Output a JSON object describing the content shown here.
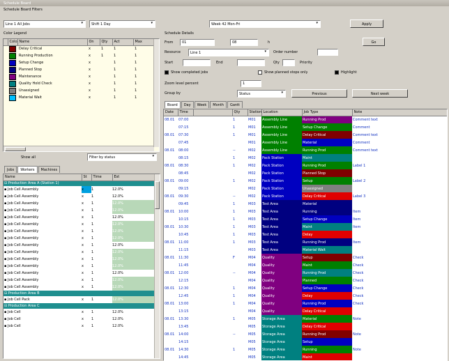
{
  "window": {
    "title": "Schedule Board"
  },
  "toolbar": {
    "group_label": "Schedule Board Filters",
    "combo1": "Line 1 All Jobs",
    "combo2": "Shift 1 Day",
    "combo3": "Week 42 Mon-Fri",
    "apply_label": "Apply"
  },
  "legend": {
    "title": "Color Legend",
    "headers": [
      "",
      "Color",
      "Name",
      "On",
      "Qty",
      "Act",
      "Max"
    ],
    "rows": [
      {
        "color": "#800000",
        "name": "Delay Critical",
        "on": "x",
        "qty": "1",
        "act": "1",
        "max": "1"
      },
      {
        "color": "#008000",
        "name": "Running Production",
        "on": "x",
        "qty": "1",
        "act": "1",
        "max": "1"
      },
      {
        "color": "#0000c0",
        "name": "Setup Change",
        "on": "x",
        "qty": "",
        "act": "1",
        "max": "1"
      },
      {
        "color": "#000080",
        "name": "Planned Stop",
        "on": "x",
        "qty": "",
        "act": "1",
        "max": "1"
      },
      {
        "color": "#800080",
        "name": "Maintenance",
        "on": "x",
        "qty": "",
        "act": "1",
        "max": "1"
      },
      {
        "color": "#008080",
        "name": "Quality Hold Check",
        "on": "x",
        "qty": "",
        "act": "1",
        "max": "1"
      },
      {
        "color": "#808080",
        "name": "Unassigned",
        "on": "x",
        "qty": "",
        "act": "1",
        "max": "1"
      },
      {
        "color": "#00c0ff",
        "name": "Material Wait",
        "on": "x",
        "qty": "",
        "act": "1",
        "max": "1"
      }
    ],
    "footer_left": "Show all",
    "footer_right": "Filter by status"
  },
  "lowerleft": {
    "tabs": [
      "Jobs",
      "Workers",
      "Machines"
    ],
    "headers": [
      "Name",
      "St",
      "Time",
      "Est"
    ],
    "groups": [
      {
        "label": "Production Area A (Station 1)",
        "rows": [
          {
            "name": "Job Cell Assembly",
            "st": "x",
            "time": "1",
            "est": "12.0%",
            "hl": false
          },
          {
            "name": "Job Cell Assembly",
            "st": "x",
            "time": "1",
            "est": "12.0%",
            "hl": false
          },
          {
            "name": "Job Cell Assembly",
            "st": "x",
            "time": "1",
            "est": "12.0%",
            "hl": true
          },
          {
            "name": "Job Cell Assembly",
            "st": "x",
            "time": "1",
            "est": "12.0%",
            "hl": true
          },
          {
            "name": "Job Cell Assembly",
            "st": "x",
            "time": "1",
            "est": "12.0%",
            "hl": false
          },
          {
            "name": "Job Cell Assembly",
            "st": "x",
            "time": "1",
            "est": "12.0%",
            "hl": true
          },
          {
            "name": "Job Cell Assembly",
            "st": "x",
            "time": "1",
            "est": "12.0%",
            "hl": true
          },
          {
            "name": "Job Cell Assembly",
            "st": "x",
            "time": "1",
            "est": "12.0%",
            "hl": true
          },
          {
            "name": "Job Cell Assembly",
            "st": "x",
            "time": "1",
            "est": "12.0%",
            "hl": false
          },
          {
            "name": "Job Cell Assembly",
            "st": "x",
            "time": "1",
            "est": "12.0%",
            "hl": true
          },
          {
            "name": "Job Cell Assembly",
            "st": "x",
            "time": "1",
            "est": "12.0%",
            "hl": true
          },
          {
            "name": "Job Cell Assembly",
            "st": "x",
            "time": "1",
            "est": "12.0%",
            "hl": true
          },
          {
            "name": "Job Cell Assembly",
            "st": "x",
            "time": "1",
            "est": "12.0%",
            "hl": false
          },
          {
            "name": "Job Cell Assembly",
            "st": "x",
            "time": "1",
            "est": "12.0%",
            "hl": true
          },
          {
            "name": "Job Cell Assembly",
            "st": "x",
            "time": "1",
            "est": "12.0%",
            "hl": true
          }
        ]
      },
      {
        "label": "Production Area B",
        "rows": [
          {
            "name": "Job Cell Pack",
            "st": "x",
            "time": "1",
            "est": "12.0%",
            "hl": true
          }
        ]
      },
      {
        "label": "Production Area C",
        "rows": [
          {
            "name": "Job Cell",
            "st": "x",
            "time": "1",
            "est": "12.0%",
            "hl": false
          },
          {
            "name": "Job Cell",
            "st": "x",
            "time": "1",
            "est": "12.0%",
            "hl": false
          },
          {
            "name": "Job Cell",
            "st": "x",
            "time": "1",
            "est": "12.0%",
            "hl": false
          }
        ]
      }
    ]
  },
  "details": {
    "title": "Schedule Details",
    "from_label": "From",
    "from_value": "01",
    "to_value": "08",
    "unit": "h",
    "go_label": "Go",
    "resource_label": "Resource",
    "resource_value": "Line 1",
    "order_label": "Order number",
    "order_value": "",
    "start_label": "Start",
    "start_value": "",
    "end_label": "End",
    "end_value": "",
    "qty_label": "Qty",
    "qty_value": "",
    "prio_label": "Priority",
    "check1": "Show completed jobs",
    "check2": "Show planned stops only",
    "check3": "Highlight",
    "zoom_label": "Zoom level percent",
    "zoom_value": "1",
    "view_label": "Group by",
    "view_value": "Status",
    "btn_prev": "Previous",
    "btn_next": "Next week"
  },
  "grid": {
    "tabs": [
      "Board",
      "Day",
      "Week",
      "Month",
      "Gantt"
    ],
    "headers": [
      "Date",
      "Time",
      "",
      "Qty",
      "Station",
      "Location",
      "Job Type",
      "Note"
    ],
    "rows": [
      {
        "d": "08.01",
        "t": "07:00",
        "q": "1",
        "s": "M01",
        "loc": "Assembly Line",
        "lc": "#008000",
        "job": "Running Prod",
        "jc": "#800080",
        "note": "Comment text",
        "tall": false
      },
      {
        "d": "",
        "t": "07:15",
        "q": "1",
        "s": "M01",
        "loc": "Assembly Line",
        "lc": "#008000",
        "job": "Setup Change",
        "jc": "#008000",
        "note": "Comment",
        "tall": false
      },
      {
        "d": "08.01",
        "t": "07:30",
        "q": "1",
        "s": "M01",
        "loc": "Assembly Line",
        "lc": "#008000",
        "job": "Delay Critical",
        "jc": "#800000",
        "note": "Comment text",
        "tall": false
      },
      {
        "d": "",
        "t": "07:45",
        "q": "",
        "s": "M01",
        "loc": "Assembly Line",
        "lc": "#008000",
        "job": "Material",
        "jc": "#0000c0",
        "note": "Comment",
        "tall": false
      },
      {
        "d": "08.01",
        "t": "08:00",
        "q": "--",
        "s": "M02",
        "loc": "Assembly Line",
        "lc": "#008000",
        "job": "Running Prod",
        "jc": "#008000",
        "note": "Comment text",
        "tall": false
      },
      {
        "d": "",
        "t": "08:15",
        "q": "1",
        "s": "M02",
        "loc": "Pack Station",
        "lc": "#0000c0",
        "job": "Maint",
        "jc": "#008080",
        "note": "",
        "tall": false
      },
      {
        "d": "08.01",
        "t": "08:30",
        "q": "1",
        "s": "M02",
        "loc": "Pack Station",
        "lc": "#0000c0",
        "job": "Running Prod",
        "jc": "#008000",
        "note": "Label 1",
        "tall": false
      },
      {
        "d": "",
        "t": "08:45",
        "q": "",
        "s": "M02",
        "loc": "Pack Station",
        "lc": "#0000c0",
        "job": "Planned Stop",
        "jc": "#800000",
        "note": "",
        "tall": false
      },
      {
        "d": "08.01",
        "t": "09:00",
        "q": "1",
        "s": "M02",
        "loc": "Pack Station",
        "lc": "#0000c0",
        "job": "Setup",
        "jc": "#008000",
        "note": "Label 2",
        "tall": false
      },
      {
        "d": "",
        "t": "09:15",
        "q": "",
        "s": "M02",
        "loc": "Pack Station",
        "lc": "#0000c0",
        "job": "Unassigned",
        "jc": "#808080",
        "note": "",
        "tall": false
      },
      {
        "d": "08.01",
        "t": "09:30",
        "q": "--",
        "s": "M02",
        "loc": "Pack Station",
        "lc": "#0000c0",
        "job": "Delay Critical",
        "jc": "#e00000",
        "note": "Label 3",
        "tall": false
      },
      {
        "d": "",
        "t": "09:45",
        "q": "1",
        "s": "M03",
        "loc": "Test Area",
        "lc": "#000080",
        "job": "Material",
        "jc": "#000080",
        "note": "",
        "tall": false
      },
      {
        "d": "08.01",
        "t": "10:00",
        "q": "1",
        "s": "M03",
        "loc": "Test Area",
        "lc": "#000080",
        "job": "Running",
        "jc": "#000080",
        "note": "Item",
        "tall": false
      },
      {
        "d": "",
        "t": "10:15",
        "q": "1",
        "s": "M03",
        "loc": "Test Area",
        "lc": "#000080",
        "job": "Setup Change",
        "jc": "#0000c0",
        "note": "Item",
        "tall": false
      },
      {
        "d": "08.01",
        "t": "10:30",
        "q": "1",
        "s": "M03",
        "loc": "Test Area",
        "lc": "#000080",
        "job": "Maint",
        "jc": "#008080",
        "note": "Item",
        "tall": false
      },
      {
        "d": "",
        "t": "10:45",
        "q": "1",
        "s": "M03",
        "loc": "Test Area",
        "lc": "#000080",
        "job": "Delay",
        "jc": "#e00000",
        "note": "",
        "tall": false
      },
      {
        "d": "08.01",
        "t": "11:00",
        "q": "1",
        "s": "M03",
        "loc": "Test Area",
        "lc": "#000080",
        "job": "Running Prod",
        "jc": "#000080",
        "note": "Item",
        "tall": false
      },
      {
        "d": "",
        "t": "11:15",
        "q": "",
        "s": "M03",
        "loc": "Test Area",
        "lc": "#000080",
        "job": "Material Wait",
        "jc": "#008080",
        "note": "",
        "tall": false
      },
      {
        "d": "08.01",
        "t": "11:30",
        "q": "F",
        "s": "M04",
        "loc": "Quality",
        "lc": "#800080",
        "job": "Setup",
        "jc": "#800000",
        "note": "Check",
        "tall": false
      },
      {
        "d": "",
        "t": "11:45",
        "q": "",
        "s": "M04",
        "loc": "Quality",
        "lc": "#800080",
        "job": "Maint",
        "jc": "#008000",
        "note": "Check",
        "tall": false
      },
      {
        "d": "08.01",
        "t": "12:00",
        "q": "--",
        "s": "M04",
        "loc": "Quality",
        "lc": "#800080",
        "job": "Running Prod",
        "jc": "#008080",
        "note": "Check",
        "tall": false
      },
      {
        "d": "",
        "t": "12:15",
        "q": "",
        "s": "M04",
        "loc": "Quality",
        "lc": "#800080",
        "job": "Planned",
        "jc": "#008000",
        "note": "Check",
        "tall": false
      },
      {
        "d": "08.01",
        "t": "12:30",
        "q": "1",
        "s": "M04",
        "loc": "Quality",
        "lc": "#800080",
        "job": "Setup Change",
        "jc": "#0000c0",
        "note": "Check",
        "tall": false
      },
      {
        "d": "",
        "t": "12:45",
        "q": "1",
        "s": "M04",
        "loc": "Quality",
        "lc": "#800080",
        "job": "Delay",
        "jc": "#e00000",
        "note": "Check",
        "tall": false
      },
      {
        "d": "08.01",
        "t": "13:00",
        "q": "1",
        "s": "M04",
        "loc": "Quality",
        "lc": "#800080",
        "job": "Running Prod",
        "jc": "#0000c0",
        "note": "Check",
        "tall": false
      },
      {
        "d": "",
        "t": "13:15",
        "q": "",
        "s": "M04",
        "loc": "Quality",
        "lc": "#800080",
        "job": "Delay Critical",
        "jc": "#e00000",
        "note": "",
        "tall": false
      },
      {
        "d": "08.01",
        "t": "13:30",
        "q": "1",
        "s": "M05",
        "loc": "Storage Area",
        "lc": "#008080",
        "job": "Material",
        "jc": "#008000",
        "note": "Note",
        "tall": false
      },
      {
        "d": "",
        "t": "13:45",
        "q": "",
        "s": "M05",
        "loc": "Storage Area",
        "lc": "#008080",
        "job": "Delay Critical",
        "jc": "#e00000",
        "note": "",
        "tall": false
      },
      {
        "d": "08.01",
        "t": "14:00",
        "q": "--",
        "s": "M05",
        "loc": "Storage Area",
        "lc": "#008080",
        "job": "Running Prod",
        "jc": "#800000",
        "note": "Note",
        "tall": false
      },
      {
        "d": "",
        "t": "14:15",
        "q": "",
        "s": "M05",
        "loc": "Storage Area",
        "lc": "#008080",
        "job": "Setup",
        "jc": "#0000c0",
        "note": "",
        "tall": false
      },
      {
        "d": "08.01",
        "t": "14:30",
        "q": "1",
        "s": "M05",
        "loc": "Storage Area",
        "lc": "#008080",
        "job": "Running",
        "jc": "#008000",
        "note": "Note",
        "tall": false
      },
      {
        "d": "",
        "t": "14:45",
        "q": "",
        "s": "M05",
        "loc": "Storage Area",
        "lc": "#008080",
        "job": "Maint",
        "jc": "#e00000",
        "note": "",
        "tall": false
      }
    ]
  }
}
